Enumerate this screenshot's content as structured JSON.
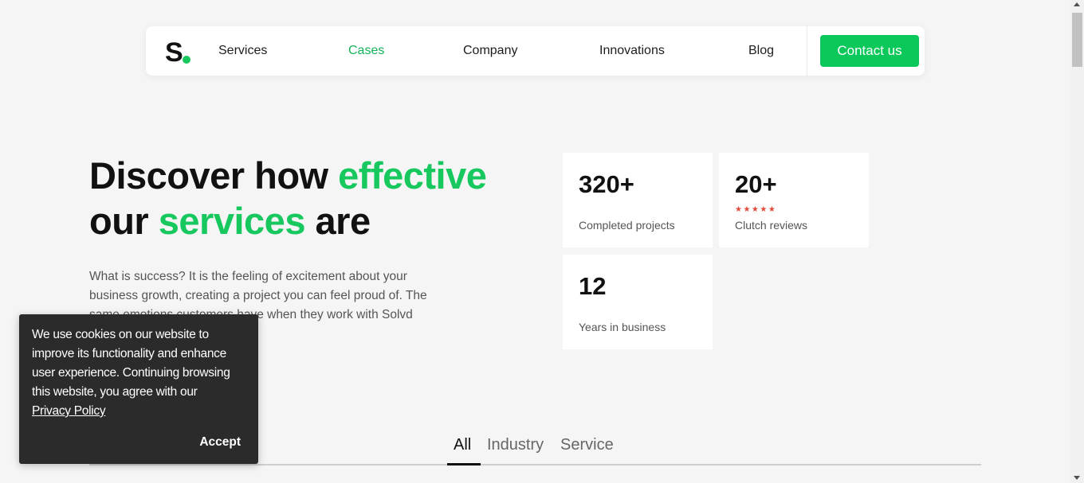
{
  "header": {
    "nav": [
      {
        "label": "Services",
        "active": false
      },
      {
        "label": "Cases",
        "active": true
      },
      {
        "label": "Company",
        "active": false
      },
      {
        "label": "Innovations",
        "active": false
      },
      {
        "label": "Blog",
        "active": false
      }
    ],
    "contact_label": "Contact us"
  },
  "hero": {
    "title_part1": "Discover how ",
    "title_accent1": "effective",
    "title_part2": "our ",
    "title_accent2": "services",
    "title_part3": " are",
    "description": "What is success? It is the feeling of excitement about your business growth, creating a project you can feel proud of. The same emotions customers have when they work with Solvd"
  },
  "stats": [
    {
      "value": "320+",
      "label": "Completed projects"
    },
    {
      "value": "20+",
      "label": "Clutch reviews",
      "stars": "★★★★★"
    },
    {
      "value": "12",
      "label": "Years in business"
    }
  ],
  "tabs": [
    {
      "label": "All",
      "active": true
    },
    {
      "label": "Industry",
      "active": false
    },
    {
      "label": "Service",
      "active": false
    }
  ],
  "cookie": {
    "text": "We use cookies on our website to improve its functionality and enhance user experience. Continuing browsing this website, you agree with our",
    "link_label": "Privacy Policy",
    "accept_label": "Accept"
  },
  "colors": {
    "accent": "#17c85f",
    "button": "#0ac85a",
    "star": "#e24a3a",
    "cookie_bg": "#2b2b2b"
  }
}
